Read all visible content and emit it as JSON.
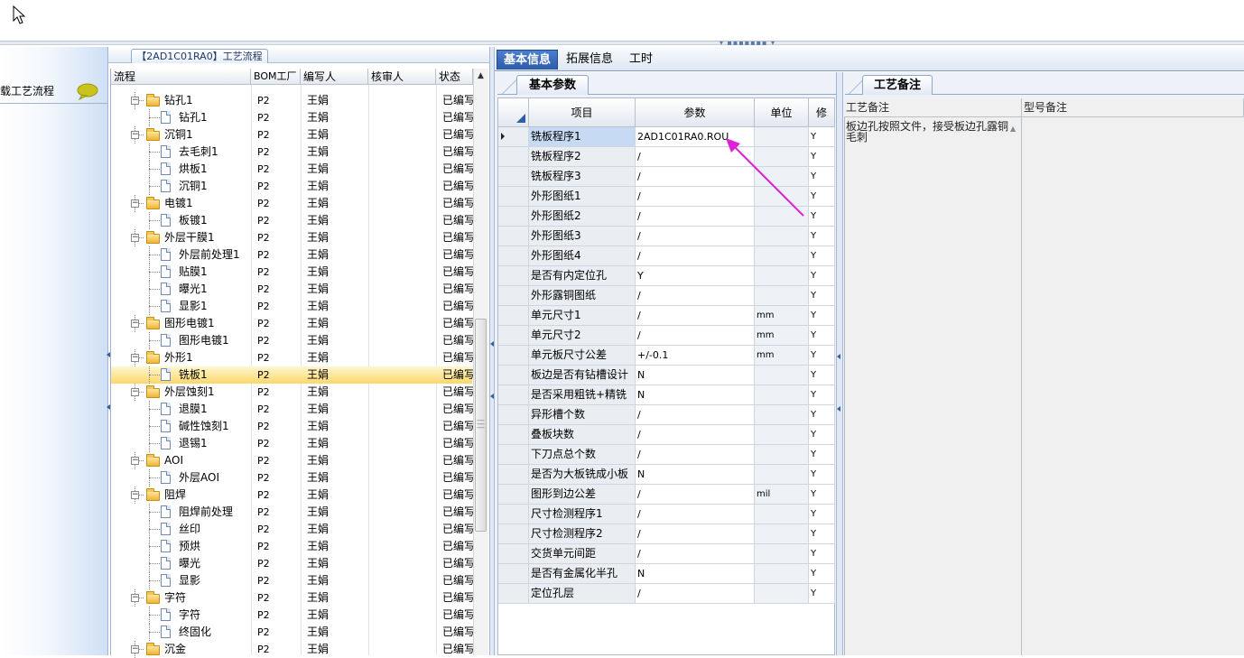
{
  "flow_tab": {
    "title": "【2AD1C01RA0】工艺流程"
  },
  "left_panel": {
    "item_label": "载工艺流程"
  },
  "tree": {
    "columns": [
      "流程",
      "BOM工厂",
      "编写人",
      "核审人",
      "状态"
    ],
    "rows": [
      {
        "name": "钻孔1",
        "level": 0,
        "bom": "P2",
        "writer": "王娟",
        "status": "已编写"
      },
      {
        "name": "钻孔1",
        "level": 1,
        "bom": "P2",
        "writer": "王娟",
        "status": "已编写"
      },
      {
        "name": "沉铜1",
        "level": 0,
        "bom": "P2",
        "writer": "王娟",
        "status": "已编写"
      },
      {
        "name": "去毛刺1",
        "level": 1,
        "bom": "P2",
        "writer": "王娟",
        "status": "已编写"
      },
      {
        "name": "烘板1",
        "level": 1,
        "bom": "P2",
        "writer": "王娟",
        "status": "已编写"
      },
      {
        "name": "沉铜1",
        "level": 1,
        "bom": "P2",
        "writer": "王娟",
        "status": "已编写"
      },
      {
        "name": "电镀1",
        "level": 0,
        "bom": "P2",
        "writer": "王娟",
        "status": "已编写"
      },
      {
        "name": "板镀1",
        "level": 1,
        "bom": "P2",
        "writer": "王娟",
        "status": "已编写"
      },
      {
        "name": "外层干膜1",
        "level": 0,
        "bom": "P2",
        "writer": "王娟",
        "status": "已编写"
      },
      {
        "name": "外层前处理1",
        "level": 1,
        "bom": "P2",
        "writer": "王娟",
        "status": "已编写"
      },
      {
        "name": "贴膜1",
        "level": 1,
        "bom": "P2",
        "writer": "王娟",
        "status": "已编写"
      },
      {
        "name": "曝光1",
        "level": 1,
        "bom": "P2",
        "writer": "王娟",
        "status": "已编写"
      },
      {
        "name": "显影1",
        "level": 1,
        "bom": "P2",
        "writer": "王娟",
        "status": "已编写"
      },
      {
        "name": "图形电镀1",
        "level": 0,
        "bom": "P2",
        "writer": "王娟",
        "status": "已编写"
      },
      {
        "name": "图形电镀1",
        "level": 1,
        "bom": "P2",
        "writer": "王娟",
        "status": "已编写"
      },
      {
        "name": "外形1",
        "level": 0,
        "bom": "P2",
        "writer": "王娟",
        "status": "已编写"
      },
      {
        "name": "铣板1",
        "level": 1,
        "bom": "P2",
        "writer": "王娟",
        "status": "已编写",
        "selected": true
      },
      {
        "name": "外层蚀刻1",
        "level": 0,
        "bom": "P2",
        "writer": "王娟",
        "status": "已编写"
      },
      {
        "name": "退膜1",
        "level": 1,
        "bom": "P2",
        "writer": "王娟",
        "status": "已编写"
      },
      {
        "name": "碱性蚀刻1",
        "level": 1,
        "bom": "P2",
        "writer": "王娟",
        "status": "已编写"
      },
      {
        "name": "退锡1",
        "level": 1,
        "bom": "P2",
        "writer": "王娟",
        "status": "已编写"
      },
      {
        "name": "AOI",
        "level": 0,
        "bom": "P2",
        "writer": "王娟",
        "status": "已编写"
      },
      {
        "name": "外层AOI",
        "level": 1,
        "bom": "P2",
        "writer": "王娟",
        "status": "已编写"
      },
      {
        "name": "阻焊",
        "level": 0,
        "bom": "P2",
        "writer": "王娟",
        "status": "已编写"
      },
      {
        "name": "阻焊前处理",
        "level": 1,
        "bom": "P2",
        "writer": "王娟",
        "status": "已编写"
      },
      {
        "name": "丝印",
        "level": 1,
        "bom": "P2",
        "writer": "王娟",
        "status": "已编写"
      },
      {
        "name": "预烘",
        "level": 1,
        "bom": "P2",
        "writer": "王娟",
        "status": "已编写"
      },
      {
        "name": "曝光",
        "level": 1,
        "bom": "P2",
        "writer": "王娟",
        "status": "已编写"
      },
      {
        "name": "显影",
        "level": 1,
        "bom": "P2",
        "writer": "王娟",
        "status": "已编写"
      },
      {
        "name": "字符",
        "level": 0,
        "bom": "P2",
        "writer": "王娟",
        "status": "已编写"
      },
      {
        "name": "字符",
        "level": 1,
        "bom": "P2",
        "writer": "王娟",
        "status": "已编写"
      },
      {
        "name": "终固化",
        "level": 1,
        "bom": "P2",
        "writer": "王娟",
        "status": "已编写"
      },
      {
        "name": "沉金",
        "level": 0,
        "bom": "P2",
        "writer": "王娟",
        "status": "已编写"
      }
    ]
  },
  "right_tabs": [
    "基本信息",
    "拓展信息",
    "工时"
  ],
  "basic_params": {
    "tab_label": "基本参数",
    "columns": [
      "项目",
      "参数",
      "单位",
      "修"
    ],
    "rows": [
      {
        "item": "铣板程序1",
        "param": "2AD1C01RA0.ROU",
        "unit": "",
        "mod": "Y"
      },
      {
        "item": "铣板程序2",
        "param": "/",
        "unit": "",
        "mod": "Y"
      },
      {
        "item": "铣板程序3",
        "param": "/",
        "unit": "",
        "mod": "Y"
      },
      {
        "item": "外形图纸1",
        "param": "/",
        "unit": "",
        "mod": "Y"
      },
      {
        "item": "外形图纸2",
        "param": "/",
        "unit": "",
        "mod": "Y"
      },
      {
        "item": "外形图纸3",
        "param": "/",
        "unit": "",
        "mod": "Y"
      },
      {
        "item": "外形图纸4",
        "param": "/",
        "unit": "",
        "mod": "Y"
      },
      {
        "item": "是否有内定位孔",
        "param": "Y",
        "unit": "",
        "mod": "Y"
      },
      {
        "item": "外形露铜图纸",
        "param": "/",
        "unit": "",
        "mod": "Y"
      },
      {
        "item": "单元尺寸1",
        "param": "/",
        "unit": "mm",
        "mod": "Y"
      },
      {
        "item": "单元尺寸2",
        "param": "/",
        "unit": "mm",
        "mod": "Y"
      },
      {
        "item": "单元板尺寸公差",
        "param": "+/-0.1",
        "unit": "mm",
        "mod": "Y"
      },
      {
        "item": "板边是否有钻槽设计",
        "param": "N",
        "unit": "",
        "mod": "Y"
      },
      {
        "item": "是否采用粗铣+精铣",
        "param": "N",
        "unit": "",
        "mod": "Y"
      },
      {
        "item": "异形槽个数",
        "param": "/",
        "unit": "",
        "mod": "Y"
      },
      {
        "item": "叠板块数",
        "param": "/",
        "unit": "",
        "mod": "Y"
      },
      {
        "item": "下刀点总个数",
        "param": "/",
        "unit": "",
        "mod": "Y"
      },
      {
        "item": "是否为大板铣成小板",
        "param": "N",
        "unit": "",
        "mod": "Y"
      },
      {
        "item": "图形到边公差",
        "param": "/",
        "unit": "mil",
        "mod": "Y"
      },
      {
        "item": "尺寸检测程序1",
        "param": "/",
        "unit": "",
        "mod": "Y"
      },
      {
        "item": "尺寸检测程序2",
        "param": "/",
        "unit": "",
        "mod": "Y"
      },
      {
        "item": "交货单元间距",
        "param": "/",
        "unit": "",
        "mod": "Y"
      },
      {
        "item": "是否有金属化半孔",
        "param": "N",
        "unit": "",
        "mod": "Y"
      },
      {
        "item": "定位孔层",
        "param": "/",
        "unit": "",
        "mod": "Y"
      }
    ]
  },
  "notes": {
    "tab_label": "工艺备注",
    "columns": [
      "工艺备注",
      "型号备注"
    ],
    "process_note": "板边孔按照文件，接受板边孔露铜毛刺",
    "model_note": ""
  },
  "colors": {
    "selected_row": "#fbd86c",
    "active_tab": "#2a5aa8",
    "annotation_arrow": "#e020d8"
  }
}
